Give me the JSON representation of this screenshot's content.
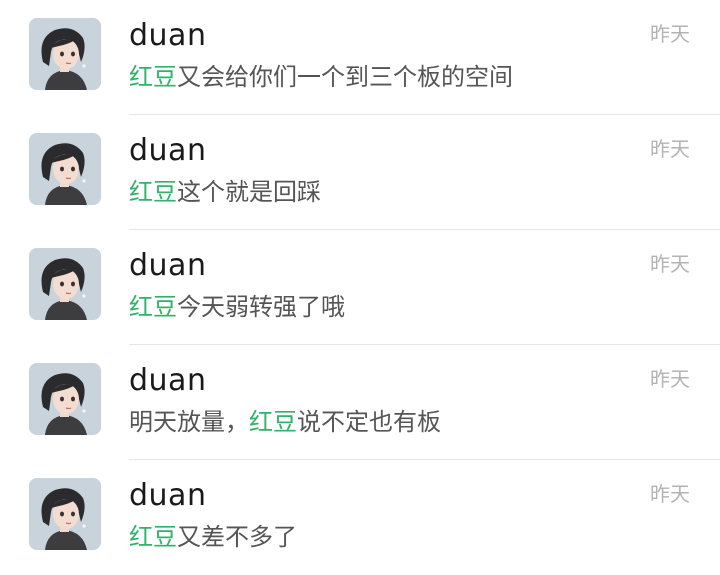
{
  "colors": {
    "highlight": "#2fb36a",
    "name_text": "#1a1a1a",
    "message_text": "#555555",
    "time_text": "#b3b3b3",
    "divider": "#e6e6e6"
  },
  "chat_list": [
    {
      "name": "duan",
      "time": "昨天",
      "avatar_icon": "cartoon-girl-avatar-icon",
      "msg_pre": "",
      "msg_hl": "红豆",
      "msg_post": "又会给你们一个到三个板的空间"
    },
    {
      "name": "duan",
      "time": "昨天",
      "avatar_icon": "cartoon-girl-avatar-icon",
      "msg_pre": "",
      "msg_hl": "红豆",
      "msg_post": "这个就是回踩"
    },
    {
      "name": "duan",
      "time": "昨天",
      "avatar_icon": "cartoon-girl-avatar-icon",
      "msg_pre": "",
      "msg_hl": "红豆",
      "msg_post": "今天弱转强了哦"
    },
    {
      "name": "duan",
      "time": "昨天",
      "avatar_icon": "cartoon-girl-avatar-icon",
      "msg_pre": "明天放量，",
      "msg_hl": "红豆",
      "msg_post": "说不定也有板"
    },
    {
      "name": "duan",
      "time": "昨天",
      "avatar_icon": "cartoon-girl-avatar-icon",
      "msg_pre": "",
      "msg_hl": "红豆",
      "msg_post": "又差不多了"
    }
  ]
}
